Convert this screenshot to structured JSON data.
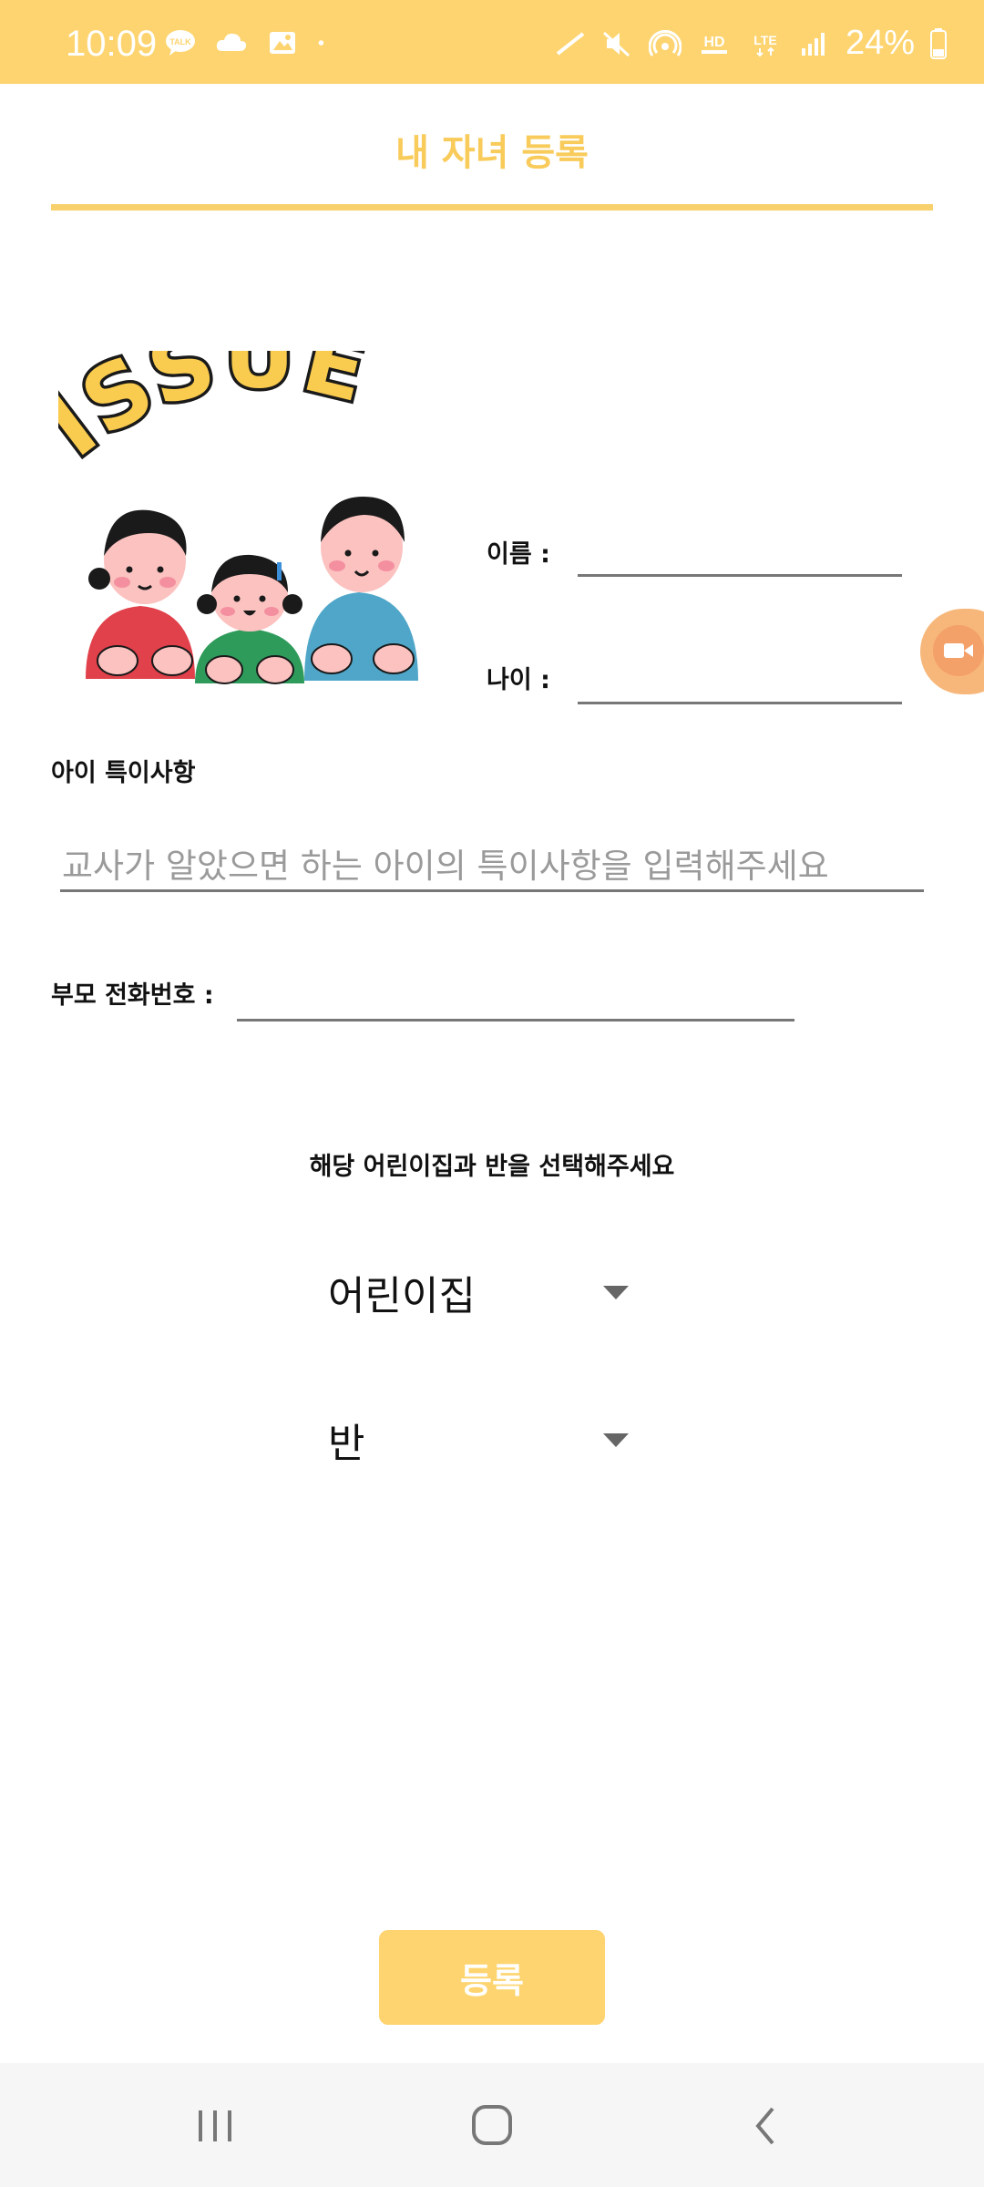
{
  "status_bar": {
    "time": "10:09",
    "battery": "24%",
    "left_icons": [
      "talk-icon",
      "cloud-icon",
      "gallery-icon",
      "dot-icon"
    ],
    "right_icons": [
      "nfc-icon",
      "mute-icon",
      "hotspot-icon",
      "hd-voice-icon",
      "lte-icon",
      "signal-icon",
      "battery-icon"
    ],
    "hd_text": "HD",
    "lte_text": "LTE"
  },
  "header": {
    "title": "내 자녀 등록",
    "accent_color": "#FDD46F"
  },
  "illustration": {
    "text": "ISSUE",
    "icon": "kids-illustration"
  },
  "form": {
    "name_label": "이름 :",
    "age_label": "나이 :",
    "notes_label": "아이 특이사항",
    "notes_placeholder": "교사가 알았으면 하는 아이의 특이사항을 입력해주세요",
    "phone_label": "부모 전화번호 :",
    "select_prompt": "해당 어린이집과 반을 선택해주세요",
    "daycare_select": "어린이집",
    "class_select": "반",
    "submit_label": "등록"
  },
  "nav_bar": {
    "icons": [
      "recent-apps-icon",
      "home-icon",
      "back-icon"
    ]
  }
}
